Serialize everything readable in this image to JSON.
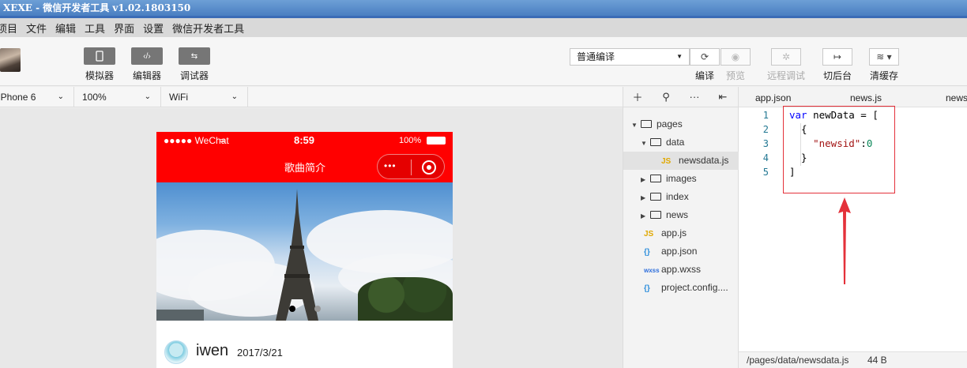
{
  "window": {
    "title": "XEXE - 微信开发者工具 v1.02.1803150"
  },
  "menu": [
    "项目",
    "文件",
    "编辑",
    "工具",
    "界面",
    "设置",
    "微信开发者工具"
  ],
  "toolbar": {
    "simulator_label": "模拟器",
    "editor_label": "编辑器",
    "debugger_label": "调试器",
    "compile_mode": "普通编译",
    "compile_label": "编译",
    "preview_label": "预览",
    "remote_debug_label": "远程调试",
    "background_label": "切后台",
    "clear_cache_label": "清缓存"
  },
  "device": {
    "model": "iPhone 6",
    "zoom": "100%",
    "network": "WiFi"
  },
  "phone": {
    "carrier": "●●●●● WeChat",
    "time": "8:59",
    "battery": "100%",
    "nav_title": "歌曲简介",
    "author": "iwen",
    "date": "2017/3/21"
  },
  "filetree": {
    "pages": "pages",
    "data": "data",
    "newsdata": "newsdata.js",
    "images": "images",
    "index": "index",
    "news": "news",
    "app_js": "app.js",
    "app_json": "app.json",
    "app_wxss": "app.wxss",
    "project_config": "project.config...."
  },
  "icons": {
    "js": "JS",
    "json": "{}",
    "wxss": "wxss"
  },
  "editor": {
    "tabs": [
      "app.json",
      "news.js",
      "news"
    ],
    "line_numbers": [
      "1",
      "2",
      "3",
      "4",
      "5"
    ],
    "code": {
      "l1_kw": "var",
      "l1_rest": " newData = [",
      "l2": "  {",
      "l3_key": "\"newsid\"",
      "l3_colon": ":",
      "l3_val": "0",
      "l4": "  }",
      "l5": "]"
    },
    "status_path": "/pages/data/newsdata.js",
    "status_size": "44 B"
  },
  "colors": {
    "nav_red": "#ff0000",
    "annotation_red": "#e4313a"
  }
}
